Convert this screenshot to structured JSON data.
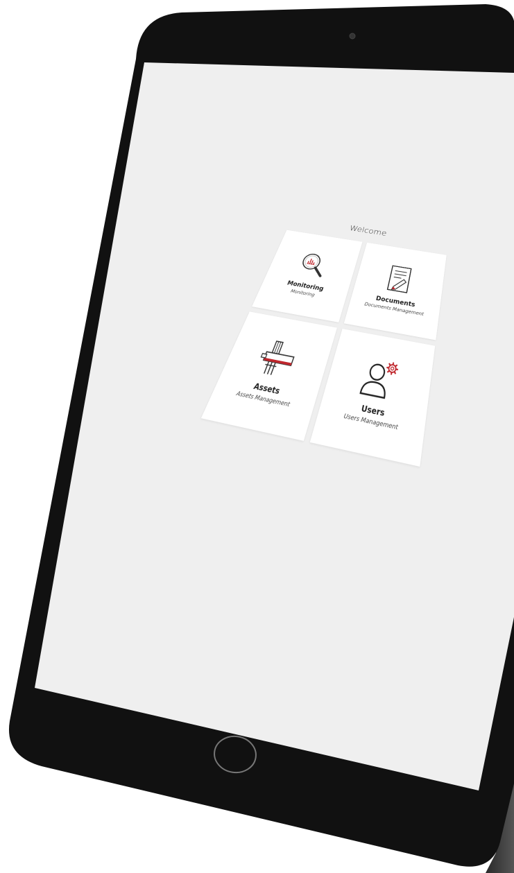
{
  "screen": {
    "welcome": "Welcome"
  },
  "tiles": [
    {
      "title": "Monitoring",
      "subtitle": "Monitoring",
      "icon": "magnifier-chart-icon"
    },
    {
      "title": "Documents",
      "subtitle": "Documents Management",
      "icon": "document-edit-icon"
    },
    {
      "title": "Assets",
      "subtitle": "Assets Management",
      "icon": "machine-asset-icon"
    },
    {
      "title": "Users",
      "subtitle": "Users Management",
      "icon": "user-settings-icon"
    }
  ],
  "colors": {
    "accent": "#c0272d",
    "screen_bg": "#efefef",
    "bezel": "#111111",
    "tile_bg": "#ffffff"
  }
}
